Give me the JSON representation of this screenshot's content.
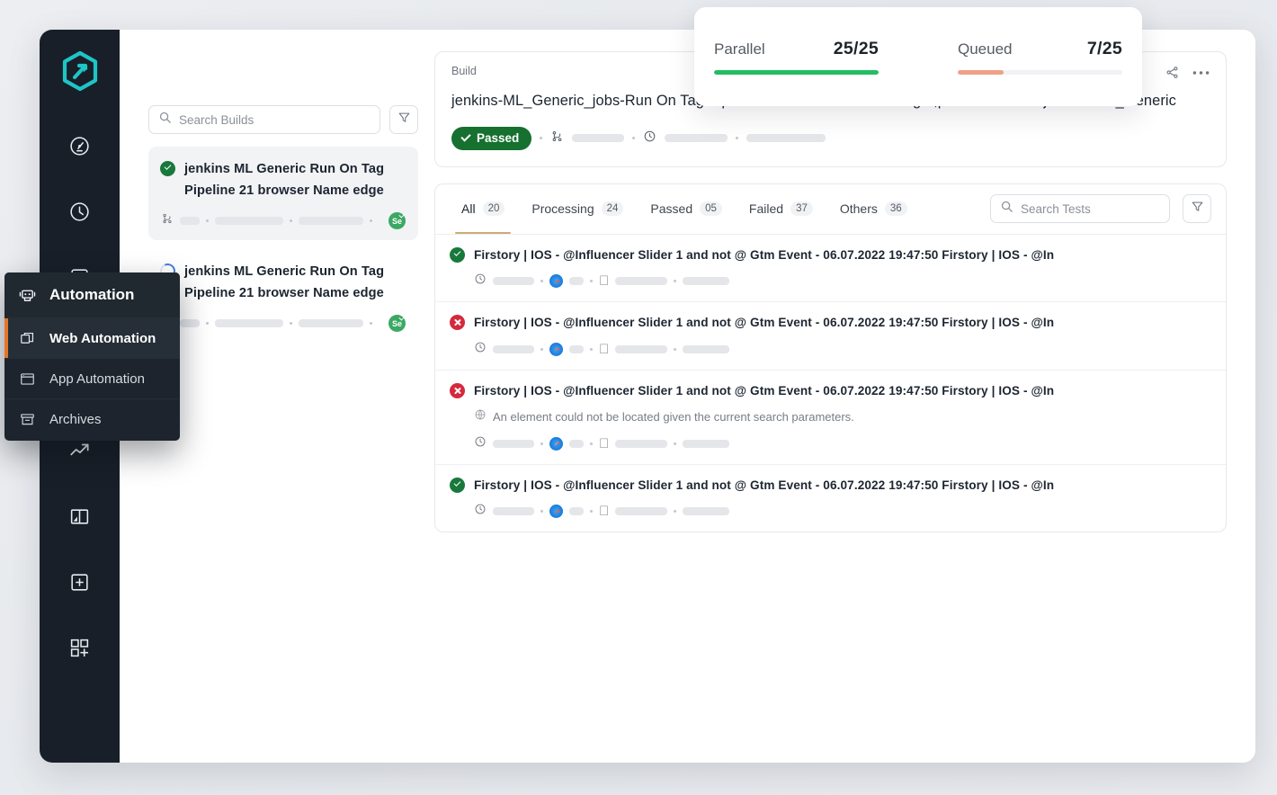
{
  "app": {
    "logo_icon": "hexagon-arrow-logo",
    "brand_color": "#1fc4c6"
  },
  "rail": {
    "items": [
      {
        "icon": "speedometer-icon",
        "name": "rail-item-dashboard"
      },
      {
        "icon": "clock-history-icon",
        "name": "rail-item-history"
      },
      {
        "icon": "automation-bolt-icon",
        "name": "rail-item-automation"
      },
      {
        "icon": "trending-up-icon",
        "name": "rail-item-insights"
      },
      {
        "icon": "split-panel-icon",
        "name": "rail-item-compare"
      },
      {
        "icon": "plus-square-icon",
        "name": "rail-item-new"
      },
      {
        "icon": "grid-add-icon",
        "name": "rail-item-apps"
      }
    ]
  },
  "flyout": {
    "header": {
      "label": "Automation",
      "icon": "robot-icon"
    },
    "items": [
      {
        "label": "Web Automation",
        "icon": "windows-stack-icon",
        "active": true
      },
      {
        "label": "App Automation",
        "icon": "app-window-icon",
        "active": false
      },
      {
        "label": "Archives",
        "icon": "archive-box-icon",
        "active": false
      }
    ],
    "accent_color": "#e4762a"
  },
  "stats": {
    "items": [
      {
        "label": "Parallel",
        "value": "25/25",
        "percent": 100,
        "color": "#22bd63"
      },
      {
        "label": "Queued",
        "value": "7/25",
        "percent": 28,
        "color": "#f0a088"
      }
    ]
  },
  "builds": {
    "search": {
      "placeholder": "Search Builds",
      "icon": "search-icon"
    },
    "filter_icon": "funnel-icon",
    "items": [
      {
        "status": "passed",
        "title": "jenkins ML Generic Run On Tag Pipeline 21 browser Name edge",
        "meta_icon": "git-branch-icon",
        "framework_badge": "Se",
        "selected": true
      },
      {
        "status": "running",
        "title": "jenkins ML Generic Run On Tag Pipeline 21 browser Name edge",
        "meta_icon": "git-branch-icon",
        "framework_badge": "Se",
        "selected": false
      }
    ]
  },
  "build_detail": {
    "kicker": "Build",
    "title": "jenkins-ML_Generic_jobs-Run On Tag Pipeline 21 browserName = edge ,platform=win10 jenkins-ML_Generic",
    "status_label": "Passed",
    "status_color": "#16702f",
    "meta_icons": [
      "git-branch-icon",
      "clock-icon"
    ],
    "actions": [
      {
        "name": "share-icon"
      },
      {
        "name": "more-options-icon"
      }
    ]
  },
  "tests": {
    "tabs": [
      {
        "label": "All",
        "count": "20",
        "active": true
      },
      {
        "label": "Processing",
        "count": "24",
        "active": false
      },
      {
        "label": "Passed",
        "count": "05",
        "active": false
      },
      {
        "label": "Failed",
        "count": "37",
        "active": false
      },
      {
        "label": "Others",
        "count": "36",
        "active": false
      }
    ],
    "search": {
      "placeholder": "Search Tests",
      "icon": "search-icon"
    },
    "filter_icon": "funnel-icon",
    "rows": [
      {
        "status": "passed",
        "title": "Firstory | IOS - @Influencer Slider 1 and not @ Gtm Event - 06.07.2022 19:47:50 Firstory | IOS - @In",
        "error": null,
        "browser_icon": "safari-icon",
        "platform_icon": "apple-icon",
        "time_icon": "clock-icon"
      },
      {
        "status": "failed",
        "title": "Firstory | IOS - @Influencer Slider 1 and not @ Gtm Event - 06.07.2022 19:47:50 Firstory | IOS - @In",
        "error": null,
        "browser_icon": "safari-icon",
        "platform_icon": "apple-icon",
        "time_icon": "clock-icon"
      },
      {
        "status": "failed",
        "title": "Firstory | IOS - @Influencer Slider 1 and not @ Gtm Event - 06.07.2022 19:47:50 Firstory | IOS - @In",
        "error": "An element could not be located given the current search parameters.",
        "error_icon": "error-globe-icon",
        "browser_icon": "safari-icon",
        "platform_icon": "apple-icon",
        "time_icon": "clock-icon"
      },
      {
        "status": "passed",
        "title": "Firstory | IOS - @Influencer Slider 1 and not @ Gtm Event - 06.07.2022 19:47:50 Firstory | IOS - @In",
        "error": null,
        "browser_icon": "safari-icon",
        "platform_icon": "apple-icon",
        "time_icon": "clock-icon"
      }
    ]
  }
}
